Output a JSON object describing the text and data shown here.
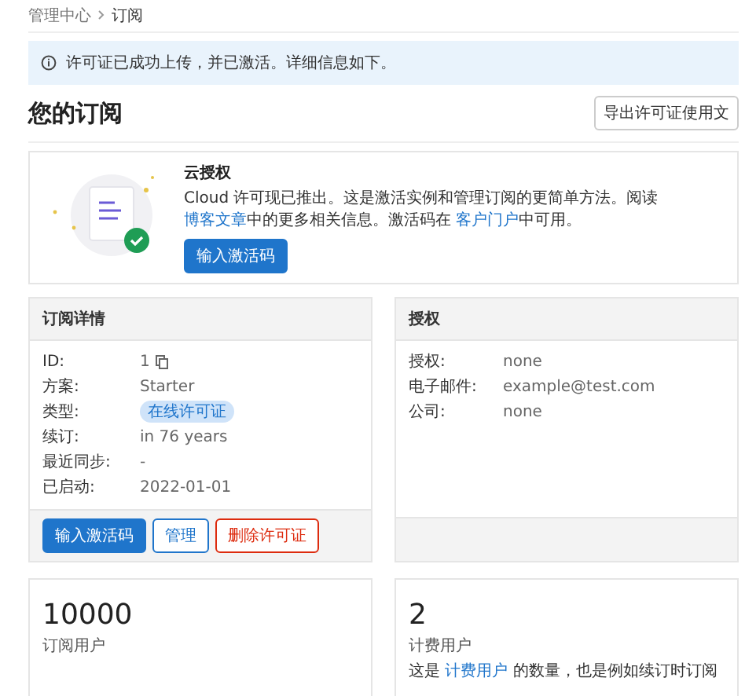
{
  "breadcrumb": [
    {
      "label": "管理中心"
    },
    {
      "label": "订阅"
    }
  ],
  "alert": {
    "text": "许可证已成功上传，并已激活。详细信息如下。"
  },
  "page_title": "您的订阅",
  "export_button": "导出许可证使用文",
  "cloud_card": {
    "title": "云授权",
    "text_parts": [
      {
        "kind": "text",
        "text": "Cloud 许可现已推出。这是激活实例和管理订阅的更简单方法。阅读 "
      },
      {
        "kind": "link",
        "text": "博客文章"
      },
      {
        "kind": "text",
        "text": "中的更多相关信息。激活码在 "
      },
      {
        "kind": "link",
        "text": "客户门户"
      },
      {
        "kind": "text",
        "text": "中可用。"
      }
    ],
    "button": "输入激活码"
  },
  "details_card": {
    "title": "订阅详情",
    "rows": [
      {
        "label": "ID:",
        "value": "1",
        "kind": "copy"
      },
      {
        "label": "方案:",
        "value": "Starter",
        "kind": "text"
      },
      {
        "label": "类型:",
        "value": "在线许可证",
        "kind": "badge"
      },
      {
        "label": "续订:",
        "value": "in 76 years",
        "kind": "text"
      },
      {
        "label": "最近同步:",
        "value": "-",
        "kind": "text"
      },
      {
        "label": "已启动:",
        "value": "2022-01-01",
        "kind": "text"
      }
    ],
    "buttons": [
      {
        "label": "输入激活码",
        "kind": "primary"
      },
      {
        "label": "管理",
        "kind": "outline"
      },
      {
        "label": "删除许可证",
        "kind": "danger"
      }
    ]
  },
  "license_card": {
    "title": "授权",
    "rows": [
      {
        "label": "授权:",
        "value": "none"
      },
      {
        "label": "电子邮件:",
        "value": "example@test.com"
      },
      {
        "label": "公司:",
        "value": "none"
      }
    ]
  },
  "stats": [
    {
      "value": "10000",
      "label": "订阅用户"
    },
    {
      "value": "2",
      "label": "计费用户",
      "note_parts": [
        {
          "kind": "text",
          "text": "这是 "
        },
        {
          "kind": "link",
          "text": "计费用户"
        },
        {
          "kind": "text",
          "text": " 的数量，也是例如续订时订阅"
        }
      ]
    }
  ]
}
